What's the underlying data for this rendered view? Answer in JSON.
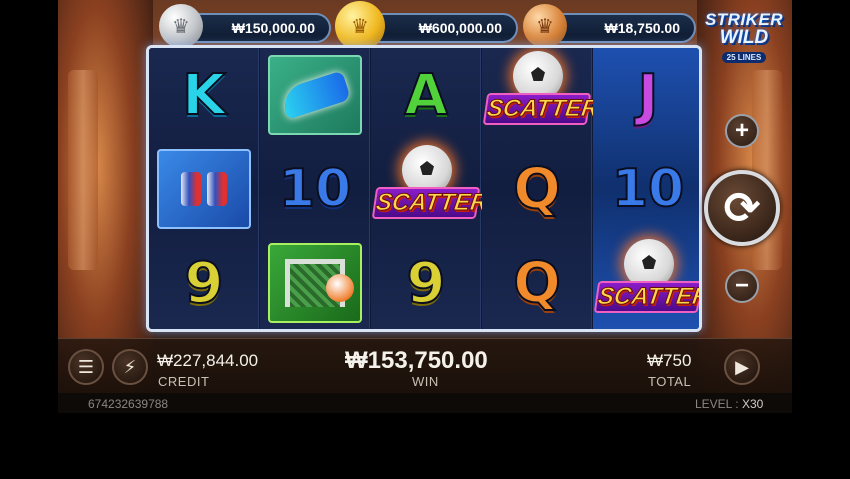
{
  "jackpots": [
    {
      "tier": "silver",
      "icon": "crown",
      "amount": "₩150,000.00"
    },
    {
      "tier": "gold",
      "icon": "crown",
      "amount": "₩600,000.00"
    },
    {
      "tier": "bronze",
      "icon": "crown",
      "amount": "₩18,750.00"
    }
  ],
  "logo": {
    "line1": "STRIKER",
    "line2": "WILD",
    "lines": "25 LINES"
  },
  "reels": [
    [
      "K",
      "cans",
      "9"
    ],
    [
      "boot",
      "10",
      "goal"
    ],
    [
      "A",
      "scatter",
      "9"
    ],
    [
      "scatter",
      "Q",
      "Q"
    ],
    [
      "J",
      "10",
      "scatter"
    ]
  ],
  "scatter_text": "SCATTER",
  "buttons": {
    "plus": "+",
    "minus": "−",
    "spin": "⟳",
    "menu": "☰",
    "turbo": "⚡",
    "autoplay": "▶"
  },
  "credit": {
    "value": "₩227,844.00",
    "label": "CREDIT"
  },
  "win": {
    "value": "₩153,750.00",
    "label": "WIN"
  },
  "total": {
    "value": "₩750",
    "label": "TOTAL"
  },
  "footer": {
    "round_id": "674232639788",
    "level_label": "LEVEL",
    "level_value": "X30"
  }
}
